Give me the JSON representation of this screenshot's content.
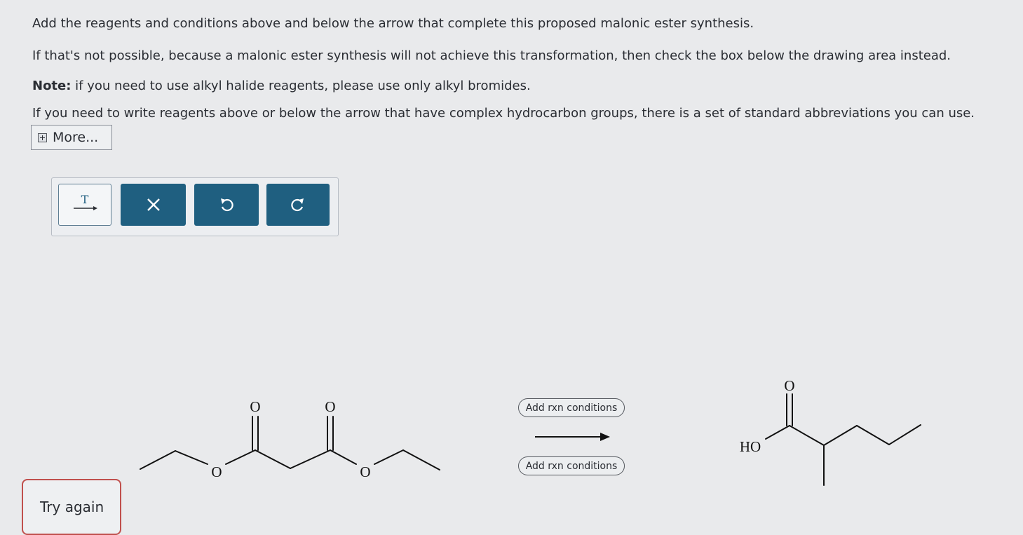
{
  "instructions": {
    "line1": "Add the reagents and conditions above and below the arrow that complete this proposed malonic ester synthesis.",
    "line2": "If that's not possible, because a malonic ester synthesis will not achieve this transformation, then check the box below the drawing area instead.",
    "note_label": "Note:",
    "note_text": " if you need to use alkyl halide reagents, please use only alkyl bromides.",
    "line4": "If you need to write reagents above or below the arrow that have complex hydrocarbon groups, there is a set of standard abbreviations you can use."
  },
  "more_button": {
    "label": "More..."
  },
  "toolbar": {
    "text_tool_icon": "text-arrow-icon",
    "clear_icon": "close-icon",
    "undo_icon": "undo-icon",
    "redo_icon": "redo-icon",
    "text_glyph": "T",
    "clear_glyph": "✕"
  },
  "reaction": {
    "above_label": "Add rxn conditions",
    "below_label": "Add rxn conditions"
  },
  "reactant": {
    "atoms": {
      "o_top_left": "O",
      "o_top_right": "O",
      "o_ester_left": "O",
      "o_ester_right": "O"
    }
  },
  "product": {
    "atoms": {
      "o_carbonyl": "O",
      "hydroxyl": "HO"
    }
  },
  "try_again": {
    "label": "Try again"
  },
  "colors": {
    "background": "#e9eaec",
    "toolbar_button": "#1f5f80",
    "try_again_border": "#c0504d"
  }
}
